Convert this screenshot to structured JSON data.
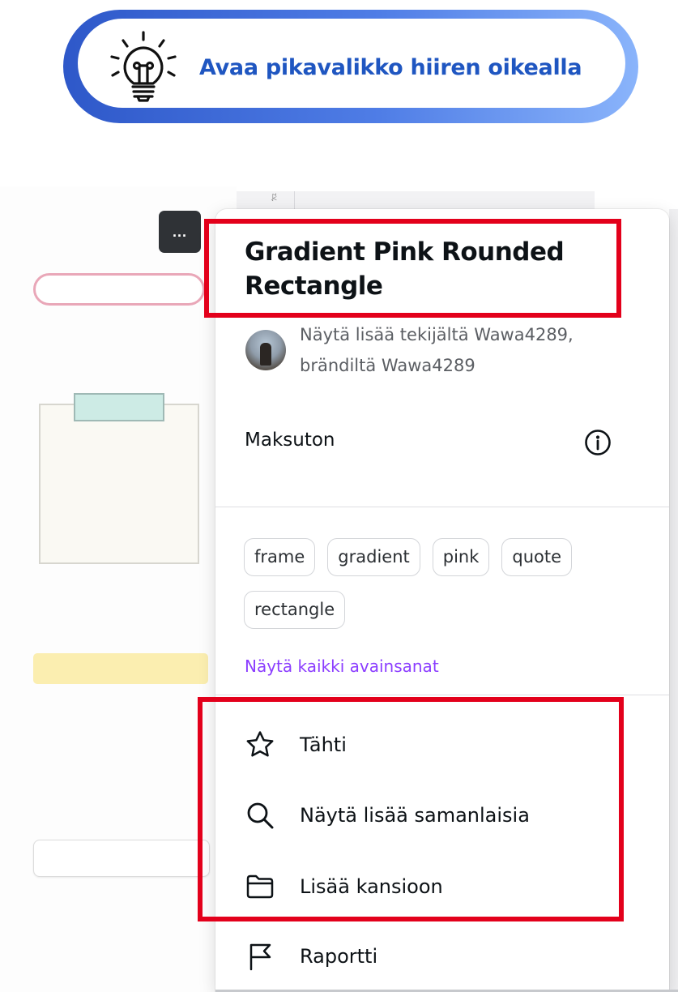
{
  "tip": {
    "icon": "lightbulb-icon",
    "text": "Avaa pikavalikko hiiren oikealla"
  },
  "background_canvas": {
    "more_button_label": "...",
    "toolbar_glyph": "ꂰ"
  },
  "panel": {
    "title": "Gradient Pink Rounded Rectangle",
    "author_line1": "Näytä lisää tekijältä Wawa4289,",
    "author_line2": "brändiltä Wawa4289",
    "license_label": "Maksuton",
    "tags": [
      "frame",
      "gradient",
      "pink",
      "quote",
      "rectangle"
    ],
    "all_keywords_link": "Näytä kaikki avainsanat",
    "menu": {
      "star": "Tähti",
      "similar": "Näytä lisää samanlaisia",
      "add_to_folder": "Lisää kansioon",
      "report": "Raportti"
    }
  },
  "colors": {
    "highlight": "#e3001b",
    "tip_text": "#1f56c1",
    "keyword_link": "#8b3dff",
    "tip_gradient": [
      "#2e58c9",
      "#8ab4fb"
    ]
  }
}
